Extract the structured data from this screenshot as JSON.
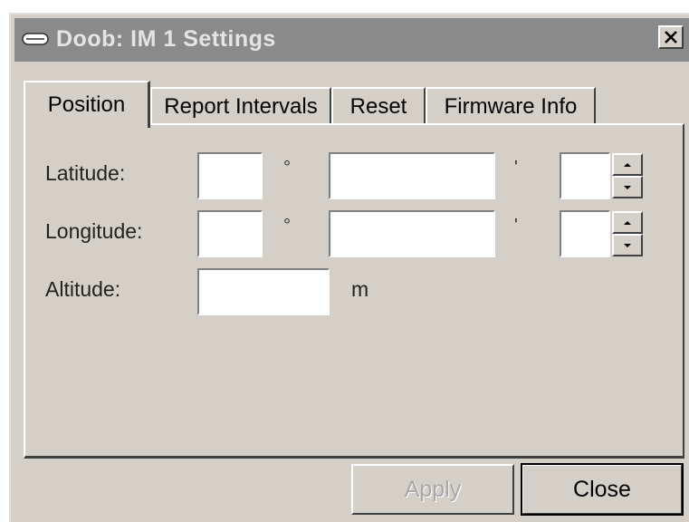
{
  "window": {
    "title": "Doob: IM 1 Settings",
    "close_glyph": "✕"
  },
  "tabs": [
    {
      "label": "Position",
      "active": true
    },
    {
      "label": "Report Intervals",
      "active": false
    },
    {
      "label": "Reset",
      "active": false
    },
    {
      "label": "Firmware Info",
      "active": false
    }
  ],
  "position": {
    "latitude": {
      "label": "Latitude:",
      "degrees": "",
      "minutes": "",
      "seconds": "",
      "degree_symbol": "°",
      "minute_symbol": "'"
    },
    "longitude": {
      "label": "Longitude:",
      "degrees": "",
      "minutes": "",
      "seconds": "",
      "degree_symbol": "°",
      "minute_symbol": "'"
    },
    "altitude": {
      "label": "Altitude:",
      "value": "",
      "unit": "m"
    }
  },
  "buttons": {
    "apply": "Apply",
    "close": "Close"
  },
  "colors": {
    "face": "#d4d0c8",
    "titlebar_inactive": "#8a8a8a",
    "disabled_text": "#a8a8a8"
  },
  "icons": {
    "app": "device-icon",
    "close": "close-icon",
    "spin_up": "spin-up-icon",
    "spin_down": "spin-down-icon"
  }
}
